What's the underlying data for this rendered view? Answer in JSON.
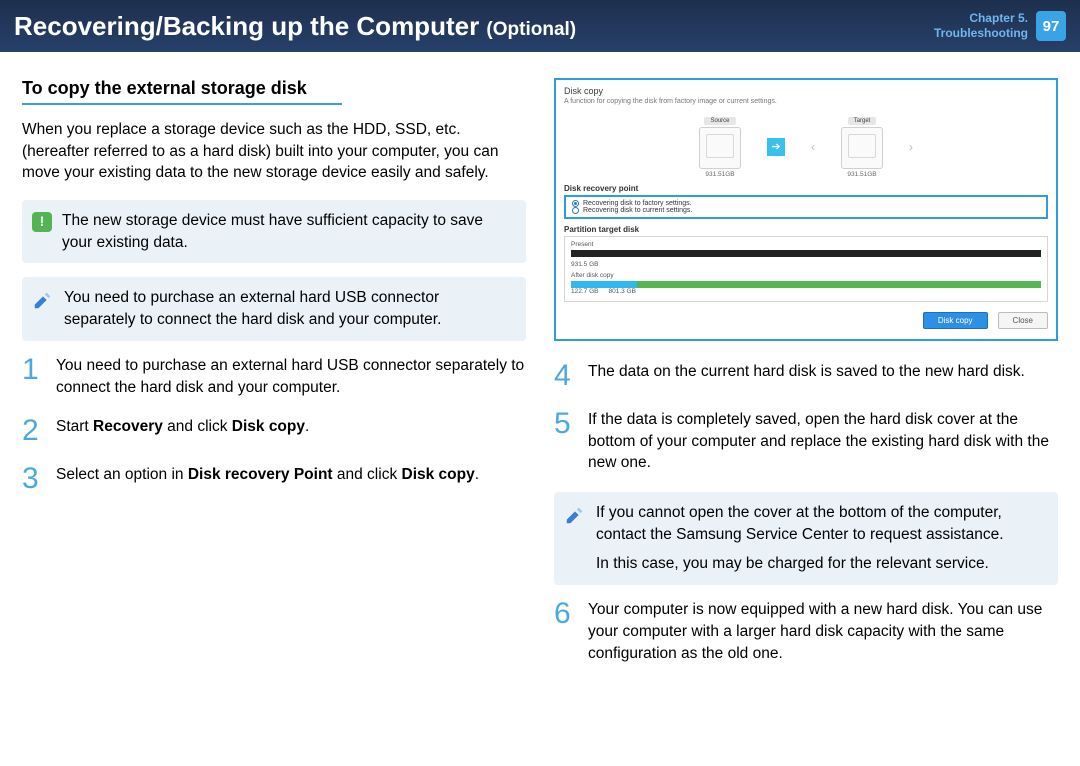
{
  "header": {
    "title": "Recovering/Backing up the Computer",
    "optional": "(Optional)",
    "chapter_line1": "Chapter 5.",
    "chapter_line2": "Troubleshooting",
    "page": "97"
  },
  "section_heading": "To copy the external storage disk",
  "intro": "When you replace a storage device such as the HDD, SSD, etc. (hereafter referred to as a hard disk) built into your computer, you can move your existing data to the new storage device easily and safely.",
  "note_warn": "The new storage device must have sufficient capacity to save your existing data.",
  "note_pen1": "You need to purchase an external hard USB connector separately to connect the hard disk and your computer.",
  "steps_left": {
    "s1": "You need to purchase an external hard USB connector separately to connect the hard disk and your computer.",
    "s2_pre": "Start ",
    "s2_b1": "Recovery",
    "s2_mid": " and click ",
    "s2_b2": "Disk copy",
    "s2_post": ".",
    "s3_pre": "Select an option in ",
    "s3_b1": "Disk recovery Point",
    "s3_mid": " and click ",
    "s3_b2": "Disk copy",
    "s3_post": "."
  },
  "steps_right": {
    "s4": "The data on the current hard disk is saved to the new hard disk.",
    "s5": "If the data is completely saved, open the hard disk cover at the bottom of your computer and replace the existing hard disk with the new one.",
    "s6": "Your computer is now equipped with a new hard disk. You can use your computer with a larger hard disk capacity with the same configuration as the old one."
  },
  "note_pen2_l1": "If you cannot open the cover at the bottom of the computer, contact the Samsung Service Center to request assistance.",
  "note_pen2_l2": "In this case, you may be charged for the relevant service.",
  "dialog": {
    "title": "Disk copy",
    "sub": "A function for copying the disk from factory image or current settings.",
    "source_tag": "Source",
    "target_tag": "Target",
    "size": "931.51GB",
    "sec1": "Disk recovery point",
    "opt1": "Recovering disk to factory settings.",
    "opt2": "Recovering disk to current settings.",
    "sec2": "Partition target disk",
    "present": "Present",
    "present_size": "931.5 GB",
    "after": "After disk copy",
    "after_a": "122.7 GB",
    "after_b": "801.3 GB",
    "btn_copy": "Disk copy",
    "btn_close": "Close"
  }
}
